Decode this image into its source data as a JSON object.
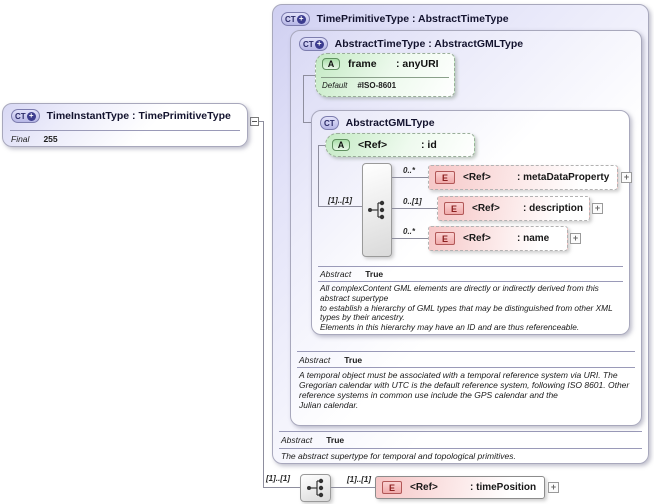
{
  "diagram": {
    "expander_glyph": "+",
    "left_box": {
      "icon": "CT",
      "title": "TimeInstantType : TimePrimitiveType",
      "final_label": "Final",
      "final_value": "255"
    },
    "time_primitive": {
      "icon": "CT",
      "title": "TimePrimitiveType : AbstractTimeType",
      "abstract_label": "Abstract",
      "abstract_value": "True",
      "doc": "The abstract supertype for temporal and topological primitives."
    },
    "abstract_time": {
      "icon": "CT",
      "title": "AbstractTimeType : AbstractGMLType",
      "abstract_label": "Abstract",
      "abstract_value": "True",
      "doc": "A temporal object must be associated with a temporal reference system via URI. The Gregorian calendar with UTC is the default reference system, following ISO 8601. Other reference systems in common use include the GPS calendar and the\nJulian calendar."
    },
    "frame_attr": {
      "icon": "A",
      "name": "frame",
      "type": ": anyURI",
      "default_label": "Default",
      "default_value": "#ISO-8601"
    },
    "abstract_gml": {
      "icon": "CT",
      "title": "AbstractGMLType",
      "abstract_label": "Abstract",
      "abstract_value": "True",
      "doc": "All complexContent GML elements are directly or indirectly derived from this abstract supertype\nto establish a hierarchy of GML types that may be distinguished from other XML types by their ancestry.\nElements in this hierarchy may have an ID and are thus referenceable."
    },
    "id_attr": {
      "icon": "A",
      "name": "<Ref>",
      "type": ": id"
    },
    "gml_sequence_cardinality": "[1]..[1]",
    "elements": [
      {
        "icon": "E",
        "cardinality": "0..*",
        "name": "<Ref>",
        "type": ": metaDataProperty"
      },
      {
        "icon": "E",
        "cardinality": "0..[1]",
        "name": "<Ref>",
        "type": ": description"
      },
      {
        "icon": "E",
        "cardinality": "0..*",
        "name": "<Ref>",
        "type": ": name"
      }
    ],
    "bottom": {
      "sequence_cardinality": "[1]..[1]",
      "element_cardinality": "[1]..[1]",
      "element_icon": "E",
      "element_name": "<Ref>",
      "element_type": ": timePosition"
    }
  }
}
